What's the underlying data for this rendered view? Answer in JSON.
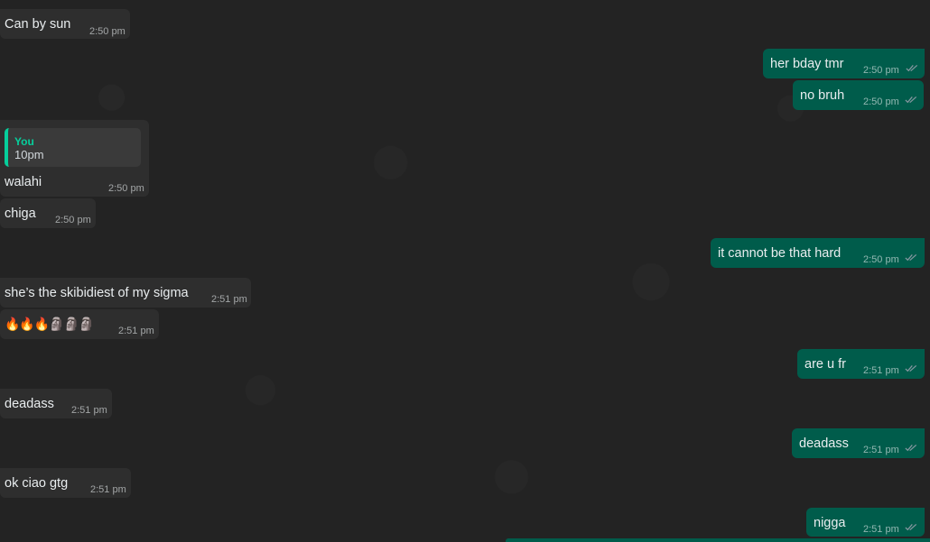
{
  "colors": {
    "chat_background": "#232323",
    "incoming_bubble": "#2e2e2e",
    "outgoing_bubble": "#005c4b",
    "quote_accent": "#06cf9c",
    "read_ticks": "#8696a0"
  },
  "messages": [
    {
      "id": "m1",
      "direction": "incoming",
      "text": "Can by sun",
      "time": "2:50 pm"
    },
    {
      "id": "m2",
      "direction": "outgoing",
      "text": "her bday tmr",
      "time": "2:50 pm",
      "status": "read"
    },
    {
      "id": "m3",
      "direction": "outgoing",
      "text": "no bruh",
      "time": "2:50 pm",
      "status": "read"
    },
    {
      "id": "m4",
      "direction": "incoming",
      "text": "walahi",
      "time": "2:50 pm",
      "quoted": {
        "author": "You",
        "text": "10pm"
      }
    },
    {
      "id": "m5",
      "direction": "incoming",
      "text": "chiga",
      "time": "2:50 pm"
    },
    {
      "id": "m6",
      "direction": "outgoing",
      "text": "it cannot be that hard",
      "time": "2:50 pm",
      "status": "read"
    },
    {
      "id": "m7",
      "direction": "incoming",
      "text": "she’s the skibidiest of my sigma",
      "time": "2:51 pm"
    },
    {
      "id": "m8",
      "direction": "incoming",
      "text": "🔥🔥🔥🗿🗿🗿",
      "time": "2:51 pm",
      "emoji_only": true
    },
    {
      "id": "m9",
      "direction": "outgoing",
      "text": "are u fr",
      "time": "2:51 pm",
      "status": "read"
    },
    {
      "id": "m10",
      "direction": "incoming",
      "text": "deadass",
      "time": "2:51 pm"
    },
    {
      "id": "m11",
      "direction": "outgoing",
      "text": "deadass",
      "time": "2:51 pm",
      "status": "read"
    },
    {
      "id": "m12",
      "direction": "incoming",
      "text": "ok ciao gtg",
      "time": "2:51 pm"
    },
    {
      "id": "m13",
      "direction": "outgoing",
      "text": "nigga",
      "time": "2:51 pm",
      "status": "read"
    }
  ]
}
